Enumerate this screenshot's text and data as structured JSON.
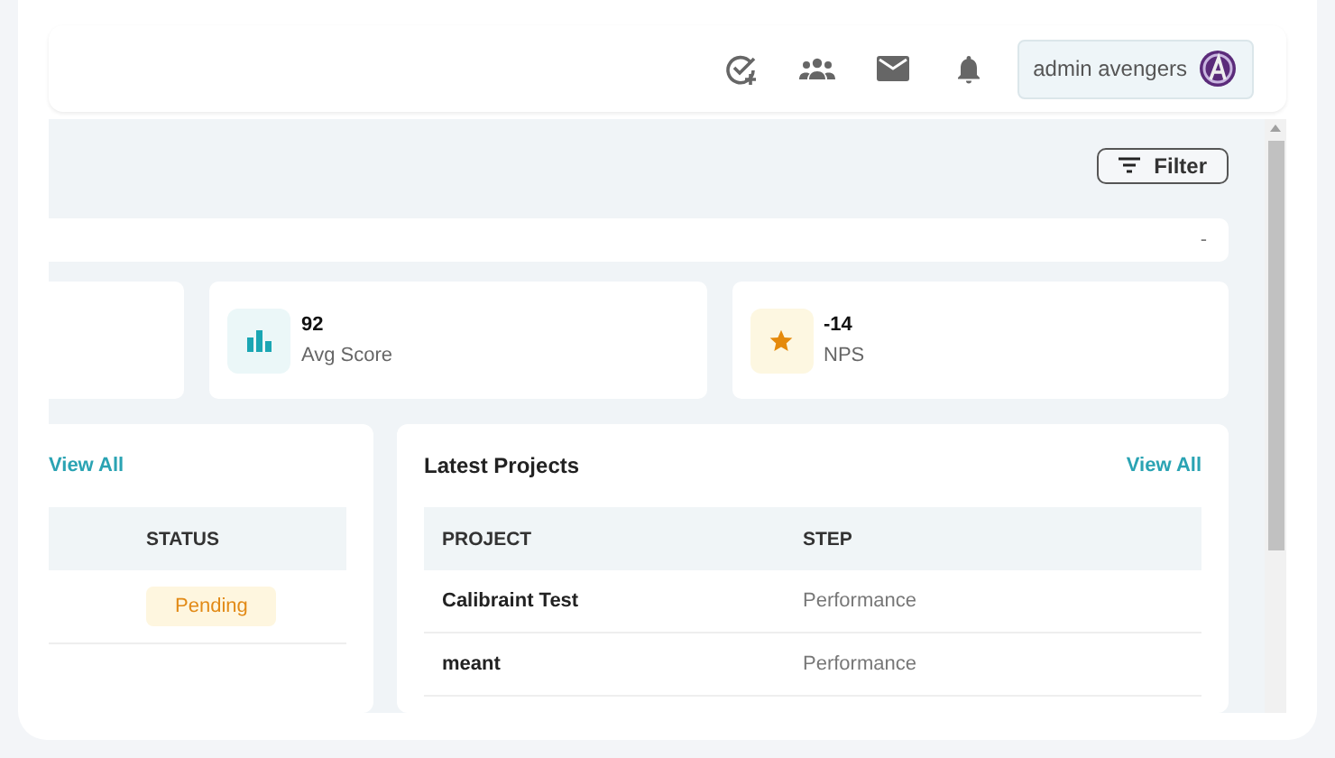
{
  "header": {
    "user": {
      "name": "admin avengers"
    }
  },
  "toolbar": {
    "filter_button": "Filter"
  },
  "summary_bar": {
    "value": "-"
  },
  "stats": [
    {
      "kind": "score",
      "value": "92",
      "label": "Avg Score"
    },
    {
      "kind": "nps",
      "value": "-14",
      "label": "NPS"
    }
  ],
  "left_panel": {
    "link": "View All",
    "columns": [
      "STATUS"
    ],
    "rows": [
      {
        "status": "Pending"
      }
    ]
  },
  "latest_projects": {
    "title": "Latest Projects",
    "link": "View All",
    "columns": [
      "PROJECT",
      "STEP"
    ],
    "rows": [
      {
        "project": "Calibraint Test",
        "step": "Performance"
      },
      {
        "project": "meant",
        "step": "Performance"
      }
    ]
  }
}
